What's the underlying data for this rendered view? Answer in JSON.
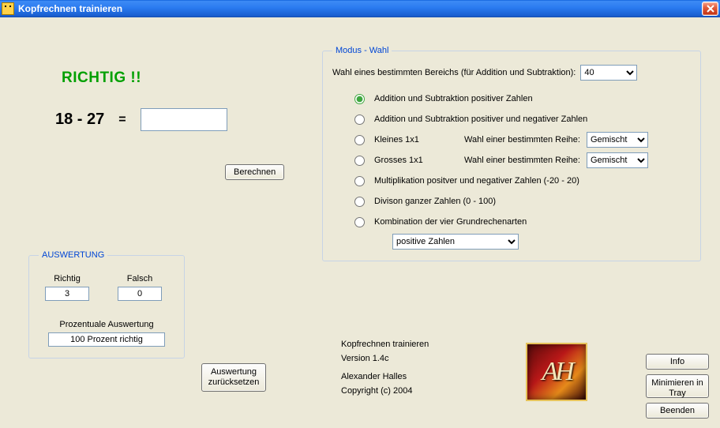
{
  "window": {
    "title": "Kopfrechnen trainieren"
  },
  "feedback": "RICHTIG !!",
  "equation": {
    "expr": "18 - 27",
    "eq": "=",
    "answer": ""
  },
  "buttons": {
    "calc": "Berechnen",
    "reset": "Auswertung zurücksetzen",
    "info": "Info",
    "minimize": "Minimieren in Tray",
    "quit": "Beenden"
  },
  "auswertung": {
    "legend": "AUSWERTUNG",
    "richtig_label": "Richtig",
    "falsch_label": "Falsch",
    "richtig": "3",
    "falsch": "0",
    "proz_label": "Prozentuale Auswertung",
    "proz_value": "100 Prozent richtig"
  },
  "modus": {
    "legend": "Modus - Wahl",
    "row1_label": "Wahl eines bestimmten Bereichs (für Addition und Subtraktion):",
    "range_value": "40",
    "opts": {
      "o1": "Addition und Subtraktion positiver Zahlen",
      "o2": "Addition und Subtraktion positiver und negativer Zahlen",
      "o3": "Kleines 1x1",
      "o4": "Grosses 1x1",
      "o5": "Multiplikation positver und negativer Zahlen (-20 - 20)",
      "o6": "Divison ganzer Zahlen (0 - 100)",
      "o7": "Kombination der vier Grundrechenarten"
    },
    "reihe_label": "Wahl einer bestimmten Reihe:",
    "reihe_value": "Gemischt",
    "combo_value": "positive Zahlen"
  },
  "about": {
    "l1": "Kopfrechnen trainieren",
    "l2": "Version 1.4c",
    "l3": "Alexander Halles",
    "l4": "Copyright (c) 2004"
  }
}
